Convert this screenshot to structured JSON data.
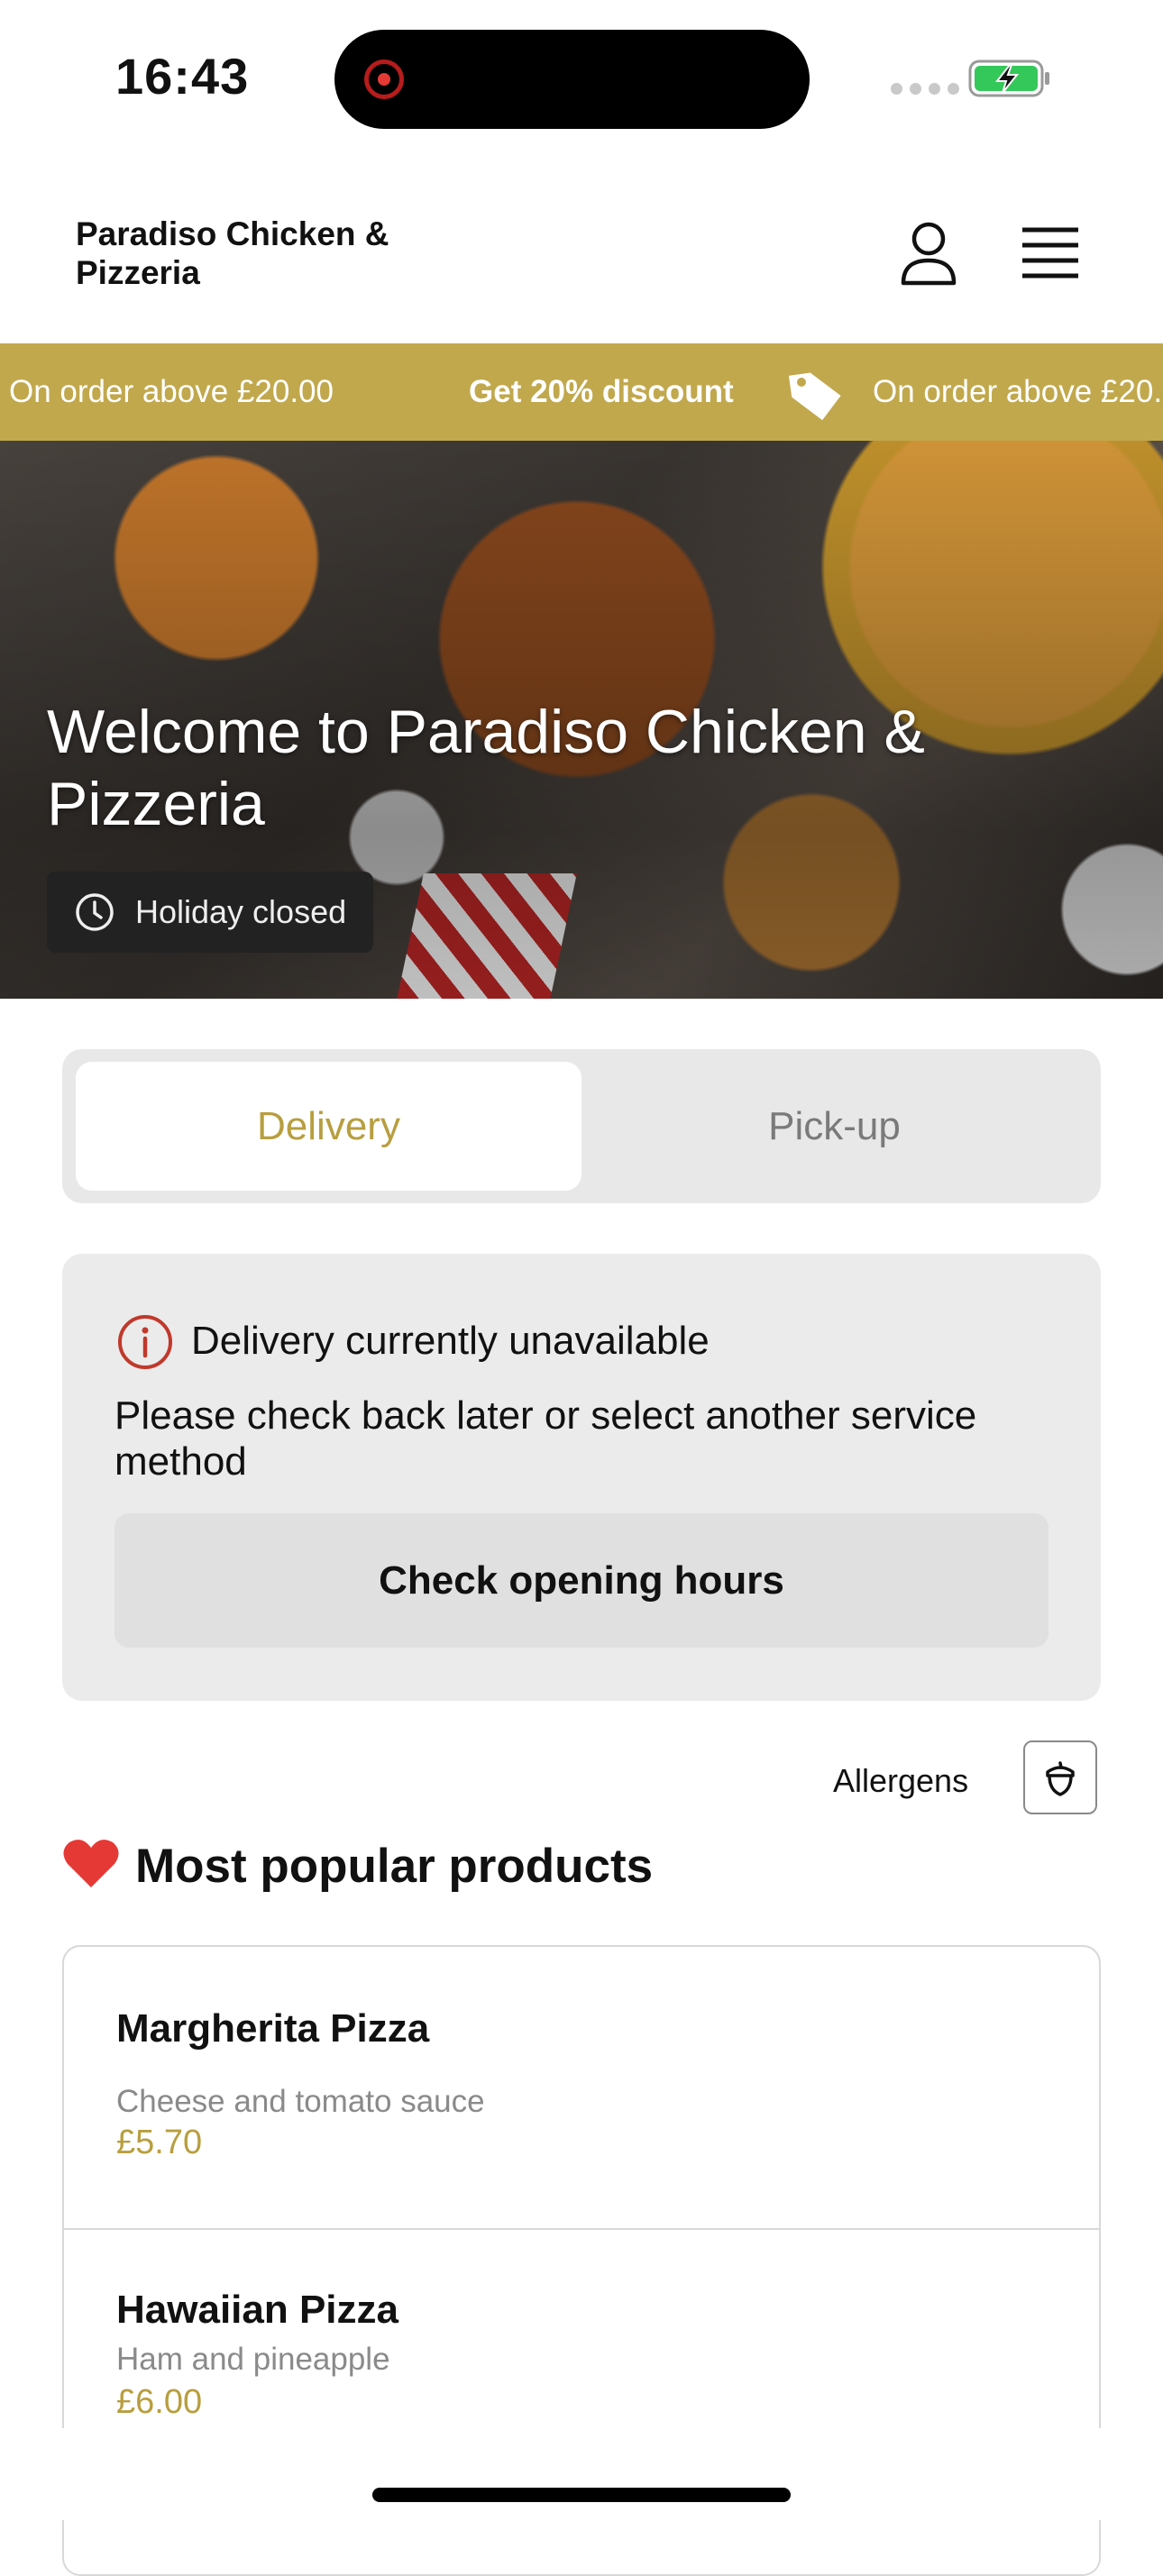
{
  "status_bar": {
    "time": "16:43"
  },
  "header": {
    "store_name": "Paradiso Chicken & Pizzeria"
  },
  "promo": {
    "left_text": "On order above £20.00",
    "center_text": "Get 20% discount",
    "right_text": "On order above £20.00"
  },
  "hero": {
    "title": "Welcome to Paradiso Chicken & Pizzeria",
    "status_badge": "Holiday closed"
  },
  "service_toggle": {
    "selected": "Delivery",
    "tabs": [
      {
        "label": "Delivery"
      },
      {
        "label": "Pick-up"
      }
    ]
  },
  "notice": {
    "title": "Delivery currently unavailable",
    "body": "Please check back later or select another service method",
    "button_label": "Check opening hours"
  },
  "allergens": {
    "label": "Allergens"
  },
  "popular": {
    "title": "Most popular products",
    "products": [
      {
        "name": "Margherita Pizza",
        "description": "Cheese and tomato sauce",
        "price": "£5.70"
      },
      {
        "name": "Hawaiian Pizza",
        "description": "Ham and pineapple",
        "price": "£6.00"
      }
    ]
  },
  "colors": {
    "accent_gold": "#c1a84d",
    "price_gold": "#b89e3f",
    "info_red": "#c0392b",
    "battery_green": "#34c759"
  },
  "icons": [
    "record-icon",
    "battery-charging-icon",
    "account-icon",
    "menu-icon",
    "tag-icon",
    "clock-icon",
    "info-icon",
    "acorn-icon",
    "heart-icon"
  ]
}
